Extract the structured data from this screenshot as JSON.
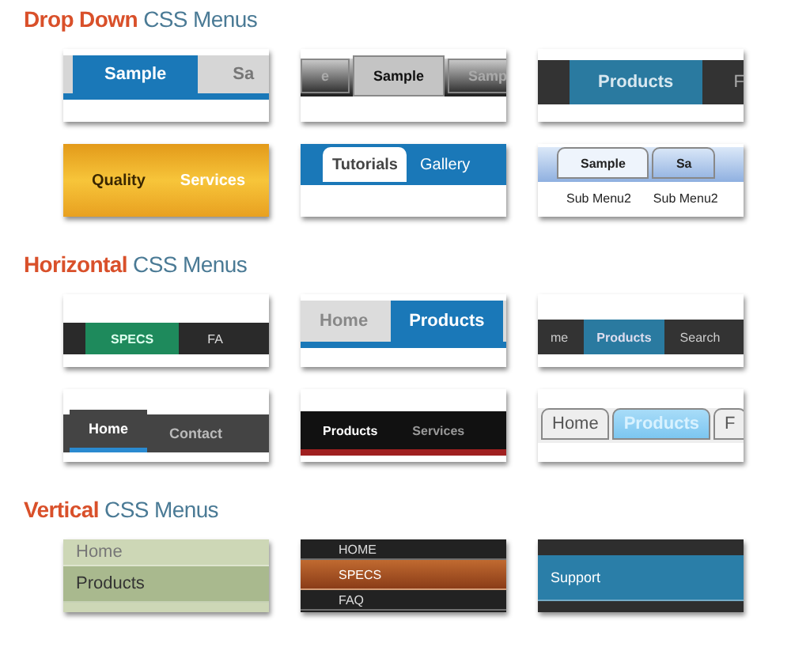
{
  "sections": [
    {
      "title_accent": "Drop Down",
      "title_rest": "CSS Menus",
      "thumbnails": [
        {
          "kind": "bluetab",
          "items": [
            {
              "label": "Sample",
              "selected": true
            },
            {
              "label": "Sa",
              "selected": false
            }
          ]
        },
        {
          "kind": "greybevel",
          "items": [
            {
              "label": "e",
              "selected": false
            },
            {
              "label": "Sample",
              "selected": true
            },
            {
              "label": "Samp",
              "selected": false
            }
          ]
        },
        {
          "kind": "darkblue",
          "items": [
            {
              "label": "Products",
              "selected": true
            },
            {
              "label": "F",
              "selected": false
            }
          ]
        },
        {
          "kind": "amber",
          "items": [
            {
              "label": "Quality",
              "selected": true
            },
            {
              "label": "Services",
              "selected": false
            }
          ]
        },
        {
          "kind": "whitetab",
          "items": [
            {
              "label": "Tutorials",
              "selected": true
            },
            {
              "label": "Gallery",
              "selected": false
            }
          ]
        },
        {
          "kind": "softblue",
          "items": [
            {
              "label": "Sample",
              "selected": true
            },
            {
              "label": "Sa",
              "selected": false
            }
          ],
          "sub_items": [
            "Sub Menu2",
            "Sub Menu2"
          ]
        }
      ]
    },
    {
      "title_accent": "Horizontal",
      "title_rest": "CSS Menus",
      "thumbnails": [
        {
          "kind": "greenstripe",
          "items": [
            {
              "label": "SPECS",
              "selected": true
            },
            {
              "label": "FA",
              "selected": false
            }
          ]
        },
        {
          "kind": "bluebig",
          "items": [
            {
              "label": "Home",
              "selected": false
            },
            {
              "label": "Products",
              "selected": true
            }
          ]
        },
        {
          "kind": "darkpointer",
          "items": [
            {
              "label": "me",
              "selected": false
            },
            {
              "label": "Products",
              "selected": true
            },
            {
              "label": "Search",
              "selected": false
            }
          ]
        },
        {
          "kind": "underline",
          "items": [
            {
              "label": "Home",
              "selected": true
            },
            {
              "label": "Contact",
              "selected": false
            }
          ]
        },
        {
          "kind": "blackred",
          "items": [
            {
              "label": "Products",
              "selected": true
            },
            {
              "label": "Services",
              "selected": false
            }
          ]
        },
        {
          "kind": "glasstabs",
          "items": [
            {
              "label": "Home",
              "selected": false
            },
            {
              "label": "Products",
              "selected": true
            },
            {
              "label": "F",
              "selected": false
            }
          ]
        }
      ]
    },
    {
      "title_accent": "Vertical",
      "title_rest": "CSS Menus",
      "thumbnails": [
        {
          "kind": "sage",
          "items": [
            {
              "label": "Home",
              "selected": false
            },
            {
              "label": "Products",
              "selected": true
            }
          ]
        },
        {
          "kind": "copper",
          "items": [
            {
              "label": "HOME",
              "selected": false
            },
            {
              "label": "SPECS",
              "selected": true
            },
            {
              "label": "FAQ",
              "selected": false
            }
          ]
        },
        {
          "kind": "slate",
          "items": [
            {
              "label": "Support",
              "selected": true
            }
          ]
        }
      ]
    }
  ]
}
